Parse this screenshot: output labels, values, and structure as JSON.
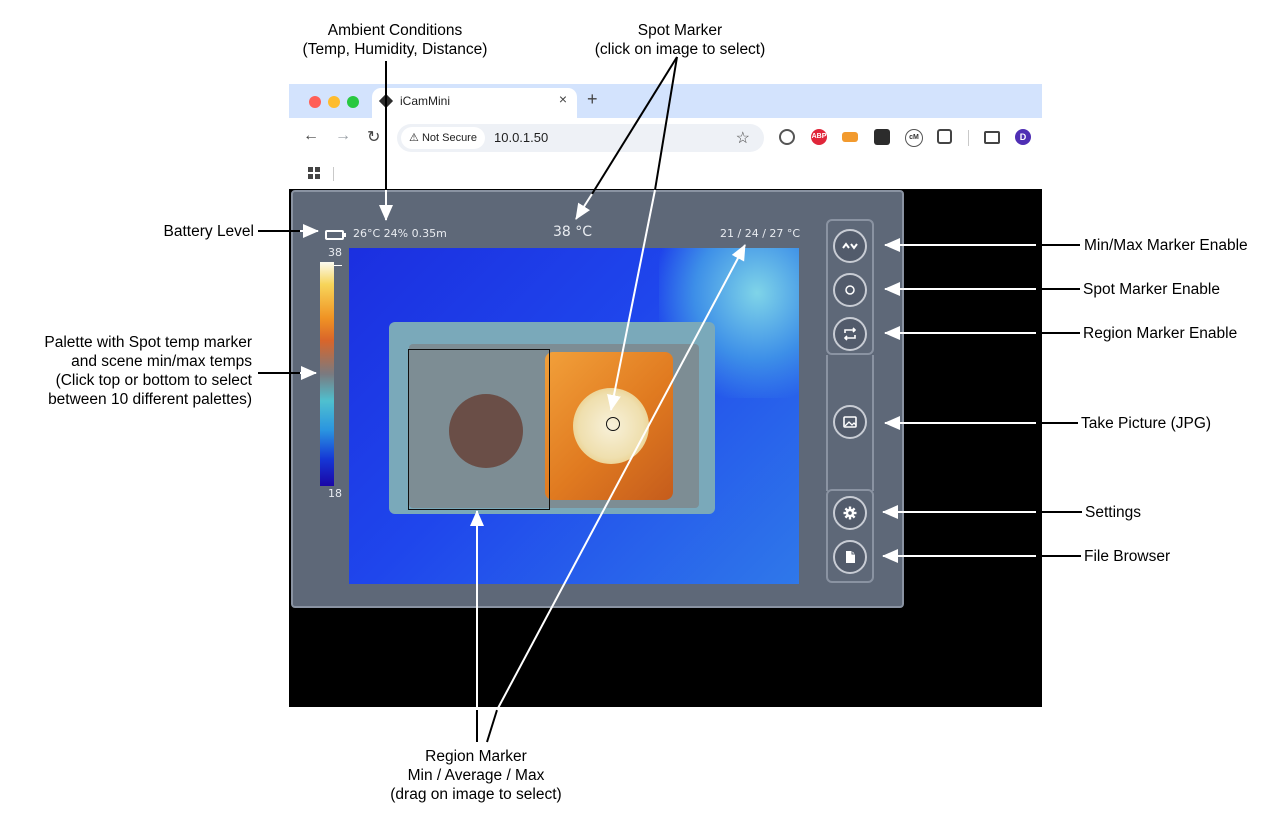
{
  "annotations": {
    "ambient_line1": "Ambient Conditions",
    "ambient_line2": "(Temp, Humidity, Distance)",
    "spot_line1": "Spot Marker",
    "spot_line2": "(click on image to select)",
    "battery": "Battery Level",
    "palette_line1": "Palette with Spot temp marker",
    "palette_line2": "and scene min/max temps",
    "palette_line3": "(Click top or bottom to select",
    "palette_line4": "between 10 different  palettes)",
    "minmax": "Min/Max Marker Enable",
    "spot_enable": "Spot Marker Enable",
    "region_enable": "Region Marker Enable",
    "take_picture": "Take Picture (JPG)",
    "settings": "Settings",
    "file_browser": "File Browser",
    "region_line1": "Region Marker",
    "region_line2": "Min / Average / Max",
    "region_line3": "(drag on image to select)"
  },
  "browser": {
    "tab_title": "iCamMini",
    "tab_close": "×",
    "new_tab": "+",
    "not_secure": "Not Secure",
    "url": "10.0.1.50",
    "back": "←",
    "forward": "→",
    "reload": "↻",
    "star": "☆",
    "avatar": "D",
    "ext_abp": "ABP",
    "ext_m": "cM"
  },
  "app": {
    "ambient": "26°C 24% 0.35m",
    "spot_temp": "38 °C",
    "region_stats": "21 / 24 / 27 °C",
    "palette_max": "38",
    "palette_min": "18"
  },
  "colors": {
    "tabstrip": "#d3e3fd",
    "app_panel": "#5e6878",
    "panel_border": "#8a93a2",
    "thermal_background": "#1f46ec",
    "hot_spot": "#f3e9c8"
  },
  "icons": [
    "battery-icon",
    "warning-icon",
    "grid-icon",
    "chevron-updown-icon",
    "circle-icon",
    "swap-icon",
    "image-icon",
    "gear-icon",
    "file-icon"
  ]
}
